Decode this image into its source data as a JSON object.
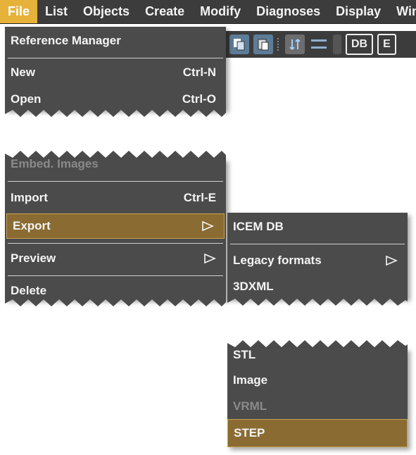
{
  "menubar": {
    "items": [
      "File",
      "List",
      "Objects",
      "Create",
      "Modify",
      "Diagnoses",
      "Display",
      "Winc"
    ]
  },
  "toolbar": {
    "db_label": "DB",
    "e_label": "E"
  },
  "file_menu_top": {
    "reference_manager": "Reference Manager",
    "new": {
      "label": "New",
      "shortcut": "Ctrl-N"
    },
    "open": {
      "label": "Open",
      "shortcut": "Ctrl-O"
    }
  },
  "file_menu_bottom": {
    "embed_images": "Embed. Images",
    "import": {
      "label": "Import",
      "shortcut": "Ctrl-E"
    },
    "export": "Export",
    "preview": "Preview",
    "delete": "Delete"
  },
  "export_submenu_top": {
    "icem_db": "ICEM DB",
    "legacy_formats": "Legacy formats",
    "threedxml": "3DXML"
  },
  "export_submenu_bottom": {
    "stl": "STL",
    "image": "Image",
    "vrml": "VRML",
    "step": "STEP"
  },
  "colors": {
    "menu_bg": "#4b4b4b",
    "menubar_bg": "#3c3c3c",
    "active_menubar": "#e7b23a",
    "highlight": "#8a6b32"
  }
}
